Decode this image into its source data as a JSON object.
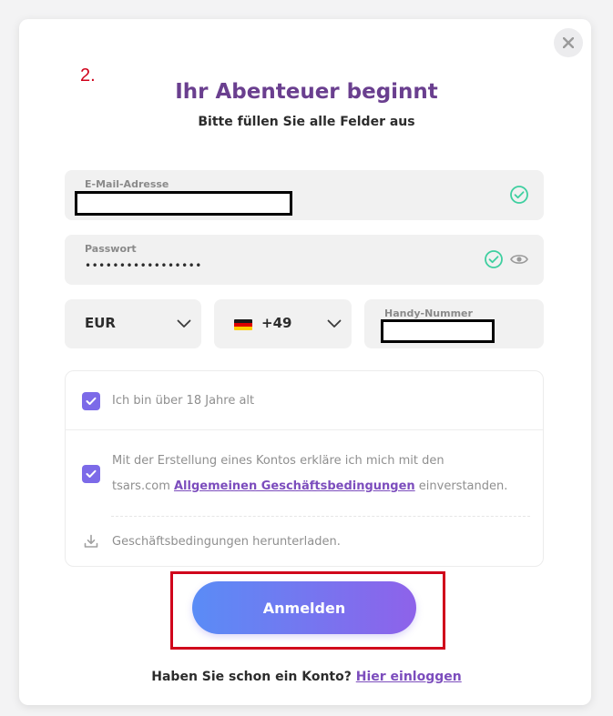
{
  "step_label": "2.",
  "dialog": {
    "title": "Ihr Abenteuer beginnt",
    "subtitle": "Bitte füllen Sie alle Felder aus"
  },
  "form": {
    "email": {
      "label": "E-Mail-Adresse",
      "value": "",
      "status_icon": "check-circle-icon"
    },
    "password": {
      "label": "Passwort",
      "value": "•••••••••••••••••",
      "status_icon": "check-circle-icon",
      "toggle_icon": "eye-icon"
    },
    "currency": {
      "value": "EUR",
      "icon": "chevron-down-icon"
    },
    "phone_code": {
      "value": "+49",
      "flag": "germany-flag-icon",
      "icon": "chevron-down-icon"
    },
    "phone": {
      "label": "Handy-Nummer",
      "value": ""
    }
  },
  "terms": {
    "age_label": "Ich bin über 18 Jahre alt",
    "age_checked": true,
    "agreement_text_1": "Mit der Erstellung eines Kontos erkläre ich mich mit den",
    "agreement_text_2_prefix": "tsars.com ",
    "agreement_link": "Allgemeinen Geschäftsbedingungen",
    "agreement_text_2_suffix": " einverstanden.",
    "agreement_checked": true,
    "download_label": "Geschäftsbedingungen herunterladen."
  },
  "submit_label": "Anmelden",
  "login": {
    "prompt": "Haben Sie schon ein Konto? ",
    "link": "Hier einloggen"
  },
  "colors": {
    "accent": "#7c4dbd",
    "title": "#6a3f8f",
    "checkbox": "#7c6ae8",
    "valid": "#3fcfa0",
    "highlight": "#d0021b"
  }
}
